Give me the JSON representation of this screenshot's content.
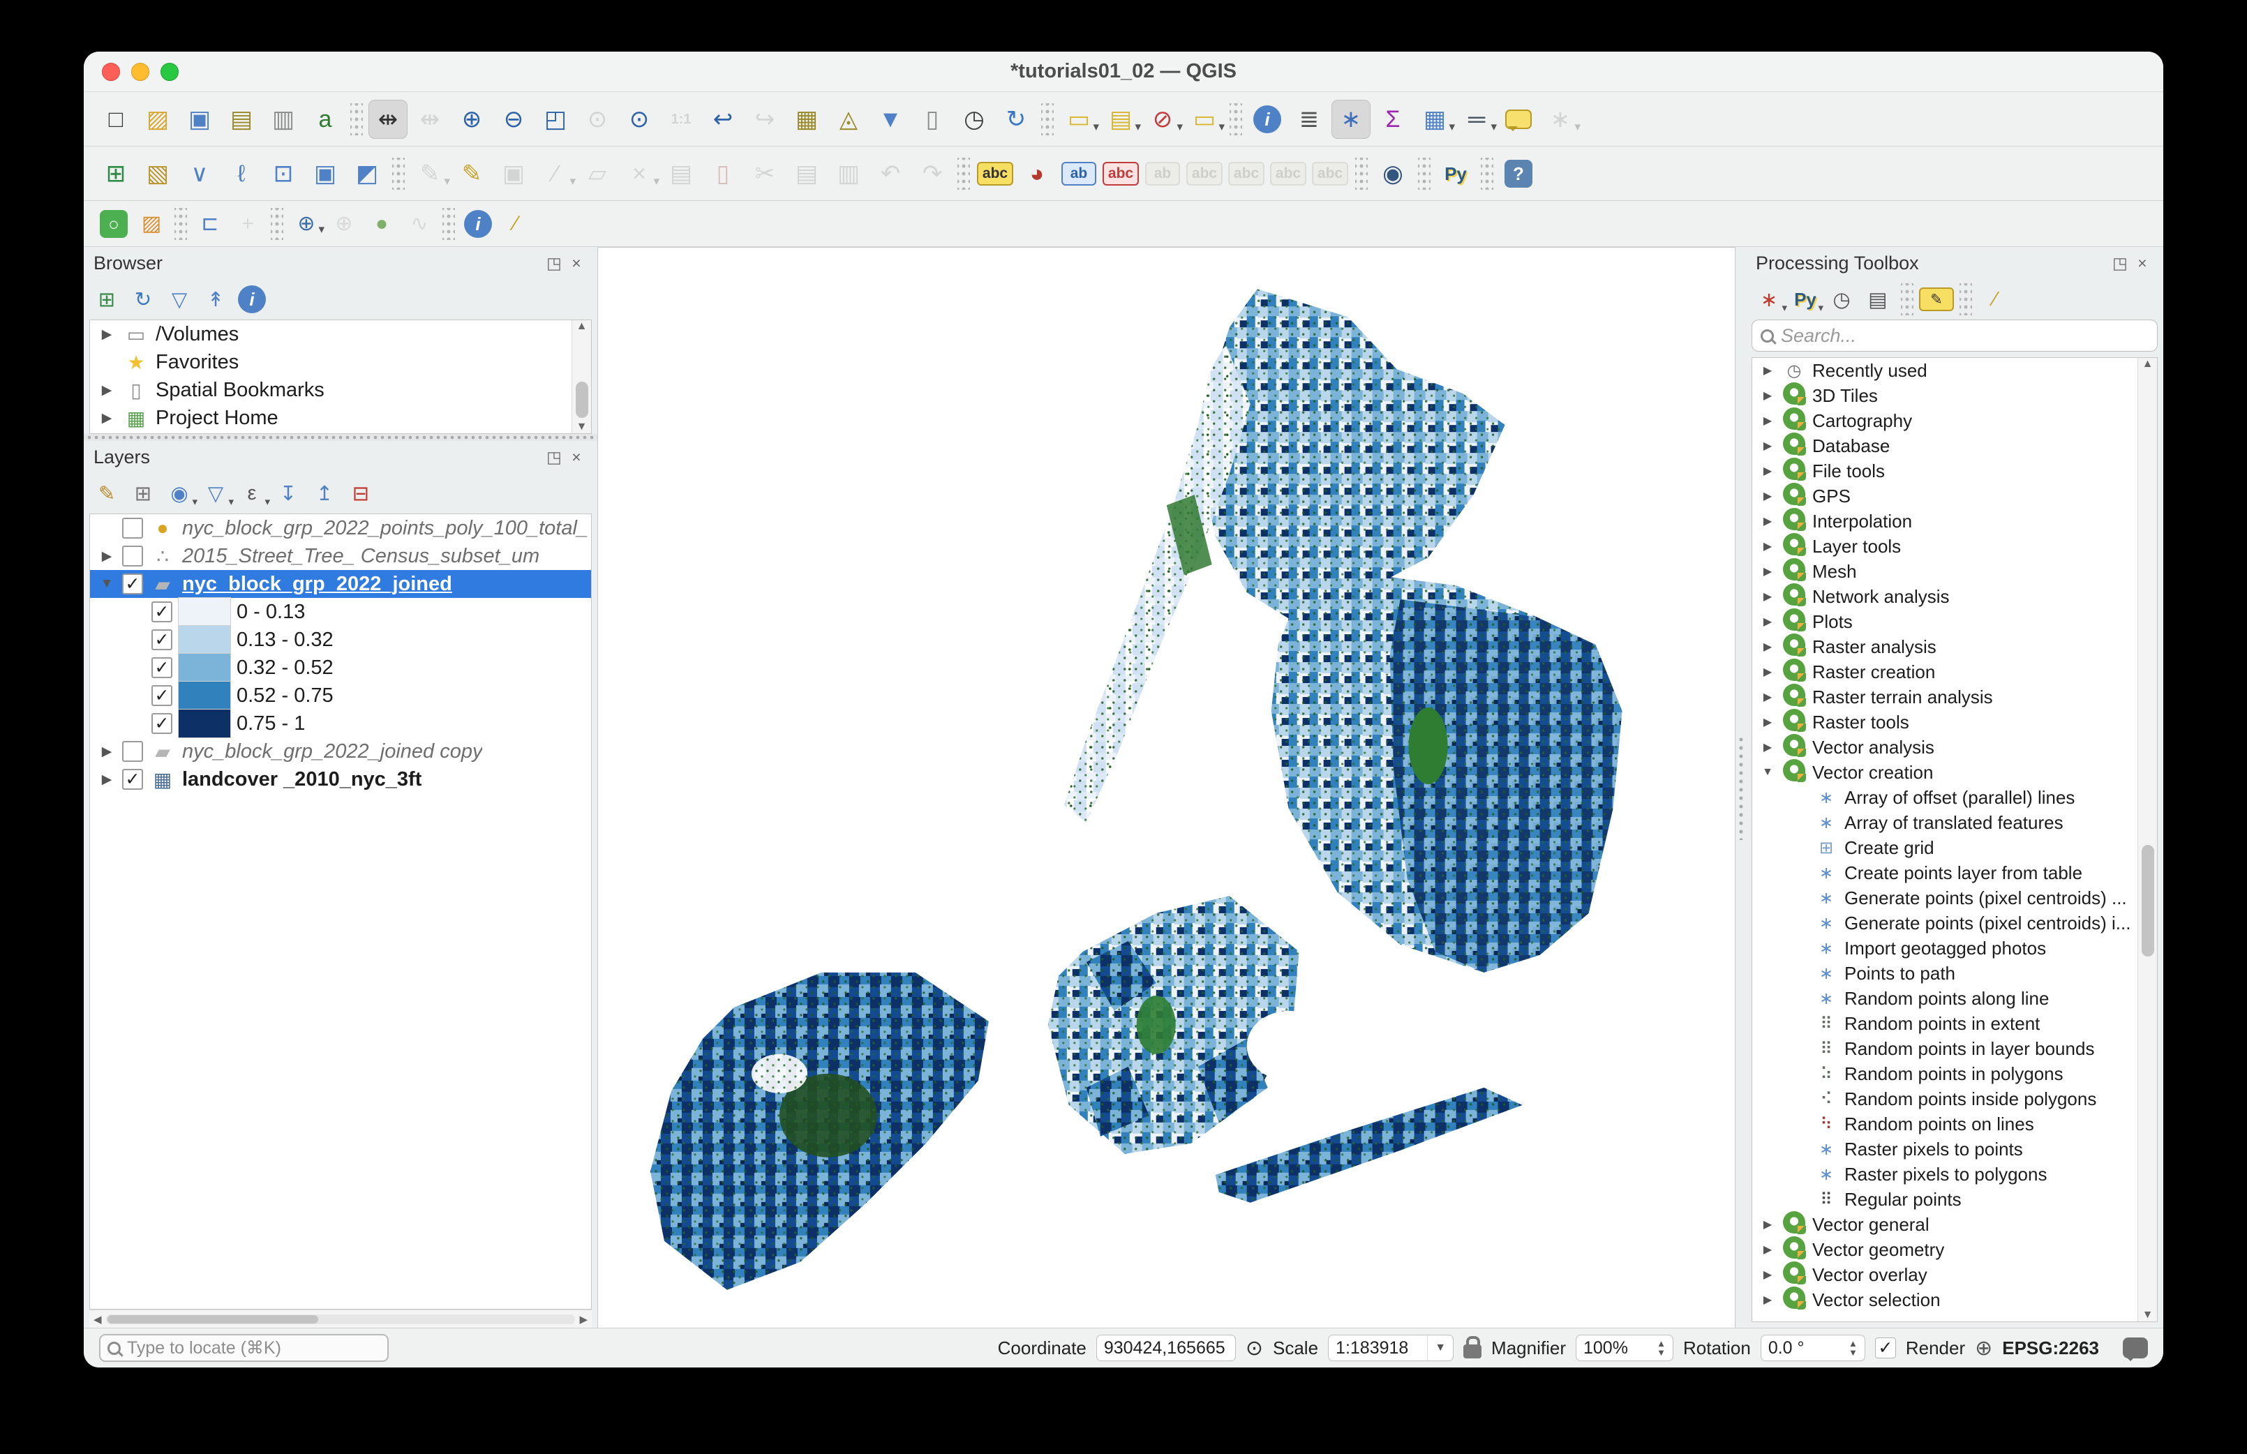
{
  "window": {
    "title": "*tutorials01_02 — QGIS"
  },
  "icons": {
    "dropdown": "▾",
    "expander_closed": "▶",
    "expander_open": "▼",
    "check": "✓",
    "scroll_up": "▲",
    "scroll_down": "▼",
    "scroll_left": "◀",
    "scroll_right": "▶",
    "float": "◳",
    "close": "×"
  },
  "legend_colors": [
    "#eef3fa",
    "#bad6ea",
    "#7cb3d9",
    "#3181bd",
    "#0d3166"
  ],
  "map_accent_green": "#1d5c1f",
  "icon_styles": {
    "folder": {
      "g": "▭",
      "c": "#8e8e8e"
    },
    "star": {
      "g": "★",
      "c": "#f2c233"
    },
    "bookmark": {
      "g": "▯",
      "c": "#8e8e8e"
    },
    "project-home": {
      "g": "▦",
      "c": "#58a14e"
    },
    "clock": {
      "g": "◷",
      "c": "#6e6e6e"
    },
    "qgis": {
      "g": "",
      "c": "",
      "cls": "qgis-logo"
    },
    "alg": {
      "g": "∗",
      "c": "#5f8fd0"
    },
    "grid": {
      "g": "⊞",
      "c": "#7aa0c8"
    },
    "dots-box": {
      "g": "⠿",
      "c": "#5e6b5e"
    },
    "dots-poly": {
      "g": "⠵",
      "c": "#5e6b5e"
    },
    "dots-blob": {
      "g": "⠪",
      "c": "#5e6b5e"
    },
    "dots-line": {
      "g": "⠳",
      "c": "#96423c"
    },
    "dots-grid": {
      "g": "⠿",
      "c": "#4a4a4a"
    },
    "pt-ellipse": {
      "g": "●",
      "c": "#d9a520"
    },
    "pt-cluster": {
      "g": "∴",
      "c": "#8a8a8a"
    },
    "poly": {
      "g": "▰",
      "c": "#b5b5b5"
    },
    "raster": {
      "g": "▦",
      "c": "#4a6d94"
    }
  },
  "toolbars": {
    "main": [
      {
        "name": "new-project",
        "glyph": "□",
        "color": "#3a3a3a"
      },
      {
        "name": "open-project",
        "glyph": "▨",
        "color": "#d9a62e"
      },
      {
        "name": "save-project",
        "glyph": "▣",
        "color": "#4f81c7"
      },
      {
        "name": "new-print-layout",
        "glyph": "▤",
        "color": "#9a8a2a"
      },
      {
        "name": "show-layout-manager",
        "glyph": "▥",
        "color": "#8a8a8a"
      },
      {
        "name": "style-manager",
        "glyph": "a",
        "color": "#2e7d32"
      },
      {
        "sep": true
      },
      {
        "name": "pan-map",
        "glyph": "⇹",
        "color": "#333333",
        "active": true
      },
      {
        "name": "pan-to-selection",
        "glyph": "⇹",
        "color": "#999999",
        "disabled": true
      },
      {
        "name": "zoom-in",
        "glyph": "⊕",
        "color": "#2c62a8"
      },
      {
        "name": "zoom-out",
        "glyph": "⊖",
        "color": "#2c62a8"
      },
      {
        "name": "zoom-full",
        "glyph": "◰",
        "color": "#2c62a8"
      },
      {
        "name": "zoom-to-selection",
        "glyph": "⊙",
        "color": "#999999",
        "disabled": true
      },
      {
        "name": "zoom-to-layer",
        "glyph": "⊙",
        "color": "#2c62a8"
      },
      {
        "name": "zoom-native",
        "glyph": "1:1",
        "small": true,
        "color": "#999999",
        "disabled": true
      },
      {
        "name": "zoom-last",
        "glyph": "↩",
        "color": "#2c62a8"
      },
      {
        "name": "zoom-next",
        "glyph": "↪",
        "color": "#999999",
        "disabled": true
      },
      {
        "name": "new-map-view",
        "glyph": "▦",
        "color": "#9a8a2a"
      },
      {
        "name": "new-3d-map-view",
        "glyph": "◬",
        "color": "#9a8a2a"
      },
      {
        "name": "new-spatial-bookmark",
        "glyph": "▼",
        "color": "#4f81c7"
      },
      {
        "name": "show-spatial-bookmarks",
        "glyph": "▯",
        "color": "#8a8a8a"
      },
      {
        "name": "temporal-controller",
        "glyph": "◷",
        "color": "#444444"
      },
      {
        "name": "refresh-map",
        "glyph": "↻",
        "color": "#3b78c3"
      },
      {
        "sep": true
      },
      {
        "name": "select-features",
        "glyph": "▭",
        "color": "#d9b62e",
        "dropdown": true
      },
      {
        "name": "select-by-value",
        "glyph": "▤",
        "color": "#d9b62e",
        "dropdown": true
      },
      {
        "name": "deselect-features",
        "glyph": "⊘",
        "color": "#c23b3b",
        "dropdown": true
      },
      {
        "name": "select-by-location",
        "glyph": "▭",
        "color": "#d9b62e",
        "dropdown": true
      },
      {
        "sep": true
      },
      {
        "name": "identify-features",
        "cls": "circ",
        "glyph": "i"
      },
      {
        "name": "statistics-abacus",
        "glyph": "≣",
        "color": "#555555"
      },
      {
        "name": "processing-toolbox-toggle",
        "glyph": "∗",
        "color": "#3f6fba",
        "active": true
      },
      {
        "name": "statistical-summary",
        "glyph": "Σ",
        "color": "#9c27b0"
      },
      {
        "name": "open-attribute-table",
        "glyph": "▦",
        "color": "#4f81c7",
        "dropdown": true
      },
      {
        "name": "measure",
        "glyph": "═",
        "color": "#44505e",
        "dropdown": true
      },
      {
        "name": "map-tips",
        "cls": "balloon",
        "glyph": ""
      },
      {
        "name": "run-feature-action",
        "glyph": "∗",
        "color": "#999999",
        "disabled": true,
        "dropdown": true
      }
    ],
    "digitizing": [
      {
        "name": "data-source-manager",
        "glyph": "⊞",
        "color": "#2e8b46"
      },
      {
        "name": "new-geopackage-layer",
        "glyph": "▧",
        "color": "#b8952c"
      },
      {
        "name": "new-shapefile-layer",
        "glyph": "∨",
        "color": "#4f81c7"
      },
      {
        "name": "new-spatialite-layer",
        "glyph": "ℓ",
        "color": "#4f81c7"
      },
      {
        "name": "new-temporary-scratch-layer",
        "glyph": "⊡",
        "color": "#4f81c7"
      },
      {
        "name": "new-virtual-layer",
        "glyph": "▣",
        "color": "#4f81c7"
      },
      {
        "name": "new-mesh-layer",
        "glyph": "◩",
        "color": "#4f81c7"
      },
      {
        "sep": true
      },
      {
        "name": "current-edits",
        "glyph": "✎",
        "color": "#999999",
        "disabled": true,
        "dropdown": true
      },
      {
        "name": "toggle-editing",
        "glyph": "✎",
        "color": "#c9a227"
      },
      {
        "name": "save-layer-edits",
        "glyph": "▣",
        "color": "#999999",
        "disabled": true
      },
      {
        "name": "digitize-with-segment",
        "glyph": "∕",
        "color": "#999999",
        "disabled": true,
        "dropdown": true
      },
      {
        "name": "add-polygon-feature",
        "glyph": "▱",
        "color": "#999999",
        "disabled": true
      },
      {
        "name": "vertex-tool",
        "glyph": "×",
        "color": "#999999",
        "disabled": true,
        "dropdown": true
      },
      {
        "name": "modify-attributes",
        "glyph": "▤",
        "color": "#999999",
        "disabled": true
      },
      {
        "name": "delete-selected",
        "glyph": "▯",
        "color": "#a05555",
        "disabled": true
      },
      {
        "name": "cut-features",
        "glyph": "✂",
        "color": "#999999",
        "disabled": true
      },
      {
        "name": "copy-features",
        "glyph": "▤",
        "color": "#999999",
        "disabled": true
      },
      {
        "name": "paste-features",
        "glyph": "▥",
        "color": "#999999",
        "disabled": true
      },
      {
        "name": "undo",
        "glyph": "↶",
        "color": "#999999",
        "disabled": true
      },
      {
        "name": "redo",
        "glyph": "↷",
        "color": "#999999",
        "disabled": true
      },
      {
        "sep": true
      },
      {
        "name": "layer-labeling-options",
        "cls": "tag tag-yellow",
        "glyph": "abc"
      },
      {
        "name": "layer-diagram-options",
        "glyph": "◕",
        "color": "#b3392e"
      },
      {
        "name": "pin-labels",
        "cls": "tag tag-blue",
        "glyph": "ab"
      },
      {
        "name": "highlight-pinned-labels",
        "cls": "tag tag-red",
        "glyph": "abc"
      },
      {
        "name": "move-label",
        "cls": "tag tag-grey",
        "glyph": "ab",
        "disabled": true
      },
      {
        "name": "show-hide-labels",
        "cls": "tag tag-grey",
        "glyph": "abc",
        "disabled": true
      },
      {
        "name": "move-label-diagram",
        "cls": "tag tag-grey",
        "glyph": "abc",
        "disabled": true
      },
      {
        "name": "rotate-label",
        "cls": "tag tag-grey",
        "glyph": "abc",
        "disabled": true
      },
      {
        "name": "change-label-properties",
        "cls": "tag tag-grey",
        "glyph": "abc",
        "disabled": true
      },
      {
        "sep": true
      },
      {
        "name": "metasearch",
        "glyph": "◉",
        "color": "#33567f"
      },
      {
        "sep": true
      },
      {
        "name": "python-console",
        "cls": "python",
        "glyph": "Py"
      },
      {
        "sep": true
      },
      {
        "name": "help-contents",
        "cls": "circ sq",
        "glyph": "?"
      }
    ],
    "plugins": [
      {
        "name": "osm-place-search",
        "cls": "circ green",
        "glyph": "○"
      },
      {
        "name": "quickmap-edit",
        "glyph": "▨",
        "color": "#d98e2e"
      },
      {
        "sep": true
      },
      {
        "name": "profile-tool",
        "glyph": "⊏",
        "color": "#4f81c7"
      },
      {
        "name": "coordinate-capture",
        "glyph": "+",
        "color": "#aaaaaa",
        "disabled": true
      },
      {
        "sep": true
      },
      {
        "name": "georef-center",
        "glyph": "⊕",
        "color": "#3b6ea5",
        "dropdown": true
      },
      {
        "name": "georef-add-point",
        "glyph": "⊕",
        "color": "#aaaaaa",
        "disabled": true
      },
      {
        "name": "new-shape-digitizing",
        "glyph": "●",
        "color": "#7fb069"
      },
      {
        "name": "freehand-digitizing",
        "glyph": "∿",
        "color": "#aaaaaa",
        "disabled": true
      },
      {
        "sep": true
      },
      {
        "name": "plugin-info",
        "cls": "circ",
        "glyph": "i"
      },
      {
        "name": "plugin-settings-wrench",
        "glyph": "∕",
        "color": "#c9a227"
      }
    ]
  },
  "browser": {
    "title": "Browser",
    "tools": [
      {
        "name": "browser-add-selected-layer",
        "glyph": "⊞",
        "color": "#3a8a4a"
      },
      {
        "name": "browser-refresh",
        "glyph": "↻",
        "color": "#3b78c3"
      },
      {
        "name": "browser-filter",
        "glyph": "▽",
        "color": "#4f81c7"
      },
      {
        "name": "browser-collapse-all",
        "glyph": "↟",
        "color": "#4f81c7"
      },
      {
        "name": "browser-properties",
        "cls": "circ",
        "glyph": "i"
      }
    ],
    "items": [
      {
        "exp": "closed",
        "icon": "folder",
        "label": "/Volumes"
      },
      {
        "icon": "star",
        "label": "Favorites"
      },
      {
        "exp": "closed",
        "icon": "bookmark",
        "label": "Spatial Bookmarks"
      },
      {
        "exp": "closed",
        "icon": "project-home",
        "label": "Project Home"
      }
    ]
  },
  "layers": {
    "title": "Layers",
    "tools": [
      {
        "name": "open-layer-styling",
        "glyph": "✎",
        "color": "#b98a2a"
      },
      {
        "name": "add-group",
        "glyph": "⊞",
        "color": "#777777"
      },
      {
        "name": "manage-map-themes",
        "glyph": "◉",
        "color": "#4f81c7",
        "dropdown": true
      },
      {
        "name": "filter-legend",
        "glyph": "▽",
        "color": "#4f81c7",
        "dropdown": true
      },
      {
        "name": "filter-by-expression",
        "glyph": "ε",
        "color": "#555555",
        "dropdown": true
      },
      {
        "name": "expand-all-layers",
        "glyph": "↧",
        "color": "#4f81c7"
      },
      {
        "name": "collapse-all-layers",
        "glyph": "↥",
        "color": "#4f81c7"
      },
      {
        "name": "remove-layer",
        "glyph": "⊟",
        "color": "#c0392b"
      }
    ],
    "items": [
      {
        "check": false,
        "icon": "pt-ellipse",
        "label": "nyc_block_grp_2022_points_poly_100_total_",
        "italic": true,
        "dim": true
      },
      {
        "exp": "closed",
        "check": false,
        "icon": "pt-cluster",
        "label": "2015_Street_Tree_ Census_subset_um",
        "italic": true,
        "dim": true
      },
      {
        "exp": "open",
        "check": true,
        "icon": "poly",
        "label": "nyc_block_grp_2022_joined",
        "selected": true,
        "bold": true,
        "underline": true
      },
      {
        "legend": true,
        "check": true,
        "swatch": "#eef3fa",
        "label": "0 - 0.13"
      },
      {
        "legend": true,
        "check": true,
        "swatch": "#bad6ea",
        "label": "0.13 - 0.32"
      },
      {
        "legend": true,
        "check": true,
        "swatch": "#7cb3d9",
        "label": "0.32 - 0.52"
      },
      {
        "legend": true,
        "check": true,
        "swatch": "#3181bd",
        "label": "0.52 - 0.75"
      },
      {
        "legend": true,
        "check": true,
        "swatch": "#0d3166",
        "label": "0.75 - 1"
      },
      {
        "exp": "closed",
        "check": false,
        "icon": "poly",
        "label": "nyc_block_grp_2022_joined copy",
        "italic": true,
        "dim": true
      },
      {
        "exp": "closed",
        "check": true,
        "icon": "raster",
        "label": "landcover _2010_nyc_3ft",
        "bold": true
      }
    ]
  },
  "toolbox": {
    "title": "Processing Toolbox",
    "tools": [
      {
        "name": "toolbox-models",
        "glyph": "∗",
        "color": "#c0392b",
        "dropdown": true
      },
      {
        "name": "toolbox-scripts",
        "cls": "python",
        "glyph": "Py",
        "dropdown": true
      },
      {
        "name": "toolbox-history",
        "glyph": "◷",
        "color": "#555555"
      },
      {
        "name": "toolbox-results-viewer",
        "glyph": "▤",
        "color": "#555555"
      },
      {
        "sep": true
      },
      {
        "name": "edit-features-in-place",
        "cls": "tag tag-yellow",
        "glyph": "✎"
      },
      {
        "sep": true
      },
      {
        "name": "toolbox-options",
        "glyph": "∕",
        "color": "#c9a227"
      }
    ],
    "search_placeholder": "Search...",
    "items": [
      {
        "d": 0,
        "exp": "closed",
        "icon": "clock",
        "label": "Recently used"
      },
      {
        "d": 0,
        "exp": "closed",
        "icon": "qgis",
        "label": "3D Tiles"
      },
      {
        "d": 0,
        "exp": "closed",
        "icon": "qgis",
        "label": "Cartography"
      },
      {
        "d": 0,
        "exp": "closed",
        "icon": "qgis",
        "label": "Database"
      },
      {
        "d": 0,
        "exp": "closed",
        "icon": "qgis",
        "label": "File tools"
      },
      {
        "d": 0,
        "exp": "closed",
        "icon": "qgis",
        "label": "GPS"
      },
      {
        "d": 0,
        "exp": "closed",
        "icon": "qgis",
        "label": "Interpolation"
      },
      {
        "d": 0,
        "exp": "closed",
        "icon": "qgis",
        "label": "Layer tools"
      },
      {
        "d": 0,
        "exp": "closed",
        "icon": "qgis",
        "label": "Mesh"
      },
      {
        "d": 0,
        "exp": "closed",
        "icon": "qgis",
        "label": "Network analysis"
      },
      {
        "d": 0,
        "exp": "closed",
        "icon": "qgis",
        "label": "Plots"
      },
      {
        "d": 0,
        "exp": "closed",
        "icon": "qgis",
        "label": "Raster analysis"
      },
      {
        "d": 0,
        "exp": "closed",
        "icon": "qgis",
        "label": "Raster creation"
      },
      {
        "d": 0,
        "exp": "closed",
        "icon": "qgis",
        "label": "Raster terrain analysis"
      },
      {
        "d": 0,
        "exp": "closed",
        "icon": "qgis",
        "label": "Raster tools"
      },
      {
        "d": 0,
        "exp": "closed",
        "icon": "qgis",
        "label": "Vector analysis"
      },
      {
        "d": 0,
        "exp": "open",
        "icon": "qgis",
        "label": "Vector creation"
      },
      {
        "d": 1,
        "icon": "alg",
        "label": "Array of offset (parallel) lines"
      },
      {
        "d": 1,
        "icon": "alg",
        "label": "Array of translated features"
      },
      {
        "d": 1,
        "icon": "grid",
        "label": "Create grid"
      },
      {
        "d": 1,
        "icon": "alg",
        "label": "Create points layer from table"
      },
      {
        "d": 1,
        "icon": "alg",
        "label": "Generate points (pixel centroids) ..."
      },
      {
        "d": 1,
        "icon": "alg",
        "label": "Generate points (pixel centroids) i..."
      },
      {
        "d": 1,
        "icon": "alg",
        "label": "Import geotagged photos"
      },
      {
        "d": 1,
        "icon": "alg",
        "label": "Points to path"
      },
      {
        "d": 1,
        "icon": "alg",
        "label": "Random points along line"
      },
      {
        "d": 1,
        "icon": "dots-box",
        "label": "Random points in extent"
      },
      {
        "d": 1,
        "icon": "dots-box",
        "label": "Random points in layer bounds"
      },
      {
        "d": 1,
        "icon": "dots-poly",
        "label": "Random points in polygons"
      },
      {
        "d": 1,
        "icon": "dots-blob",
        "label": "Random points inside polygons"
      },
      {
        "d": 1,
        "icon": "dots-line",
        "label": "Random points on lines"
      },
      {
        "d": 1,
        "icon": "alg",
        "label": "Raster pixels to points"
      },
      {
        "d": 1,
        "icon": "alg",
        "label": "Raster pixels to polygons"
      },
      {
        "d": 1,
        "icon": "dots-grid",
        "label": "Regular points"
      },
      {
        "d": 0,
        "exp": "closed",
        "icon": "qgis",
        "label": "Vector general"
      },
      {
        "d": 0,
        "exp": "closed",
        "icon": "qgis",
        "label": "Vector geometry"
      },
      {
        "d": 0,
        "exp": "closed",
        "icon": "qgis",
        "label": "Vector overlay"
      },
      {
        "d": 0,
        "exp": "closed",
        "icon": "qgis",
        "label": "Vector selection"
      }
    ]
  },
  "statusbar": {
    "locator_placeholder": "Type to locate (⌘K)",
    "coordinate_label": "Coordinate",
    "coordinate_value": "930424,165665",
    "scale_label": "Scale",
    "scale_value": "1:183918",
    "magnifier_label": "Magnifier",
    "magnifier_value": "100%",
    "rotation_label": "Rotation",
    "rotation_value": "0.0 °",
    "render_label": "Render",
    "render_checked": true,
    "crs": "EPSG:2263"
  }
}
